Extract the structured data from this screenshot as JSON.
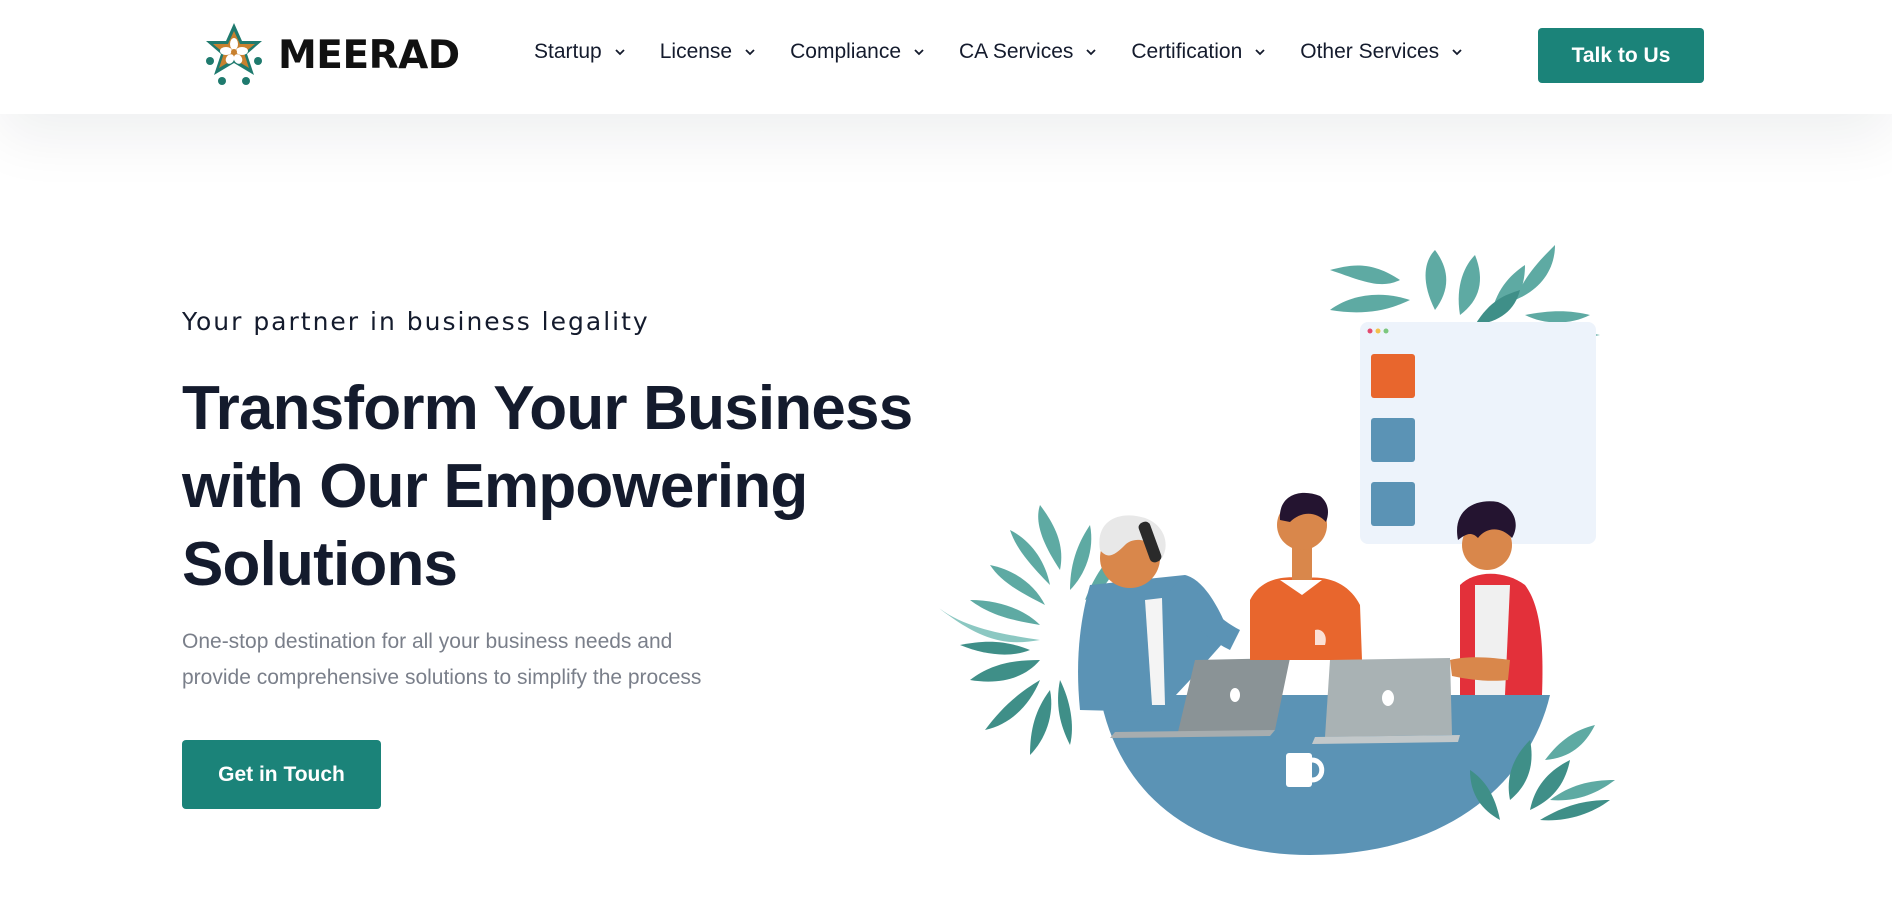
{
  "header": {
    "brand": "MEERAD",
    "logo_icon": "star-flower-logo",
    "nav": [
      {
        "label": "Startup",
        "icon": "chevron-down-icon"
      },
      {
        "label": "License",
        "icon": "chevron-down-icon"
      },
      {
        "label": "Compliance",
        "icon": "chevron-down-icon"
      },
      {
        "label": "CA Services",
        "icon": "chevron-down-icon"
      },
      {
        "label": "Certification",
        "icon": "chevron-down-icon"
      },
      {
        "label": "Other Services",
        "icon": "chevron-down-icon"
      }
    ],
    "cta_label": "Talk to Us"
  },
  "hero": {
    "tagline": "Your partner in business legality",
    "headline_line1": "Transform Your Business",
    "headline_line2": "with Our Empowering",
    "headline_line3": "Solutions",
    "description_line1": "One-stop destination for all your business needs and",
    "description_line2": "provide comprehensive solutions to simplify the process",
    "cta_label": "Get in Touch",
    "illustration": "team-working-at-table-illustration"
  },
  "colors": {
    "primary": "#1b8379",
    "heading": "#141b2d",
    "muted_text": "#7a7f8a",
    "logo_green": "#1f7a6e",
    "logo_orange": "#c8812f",
    "illustration_blue": "#5b93b5",
    "illustration_orange": "#e8662d",
    "illustration_red": "#e3303a",
    "leaf_teal": "#5eaaa3"
  }
}
